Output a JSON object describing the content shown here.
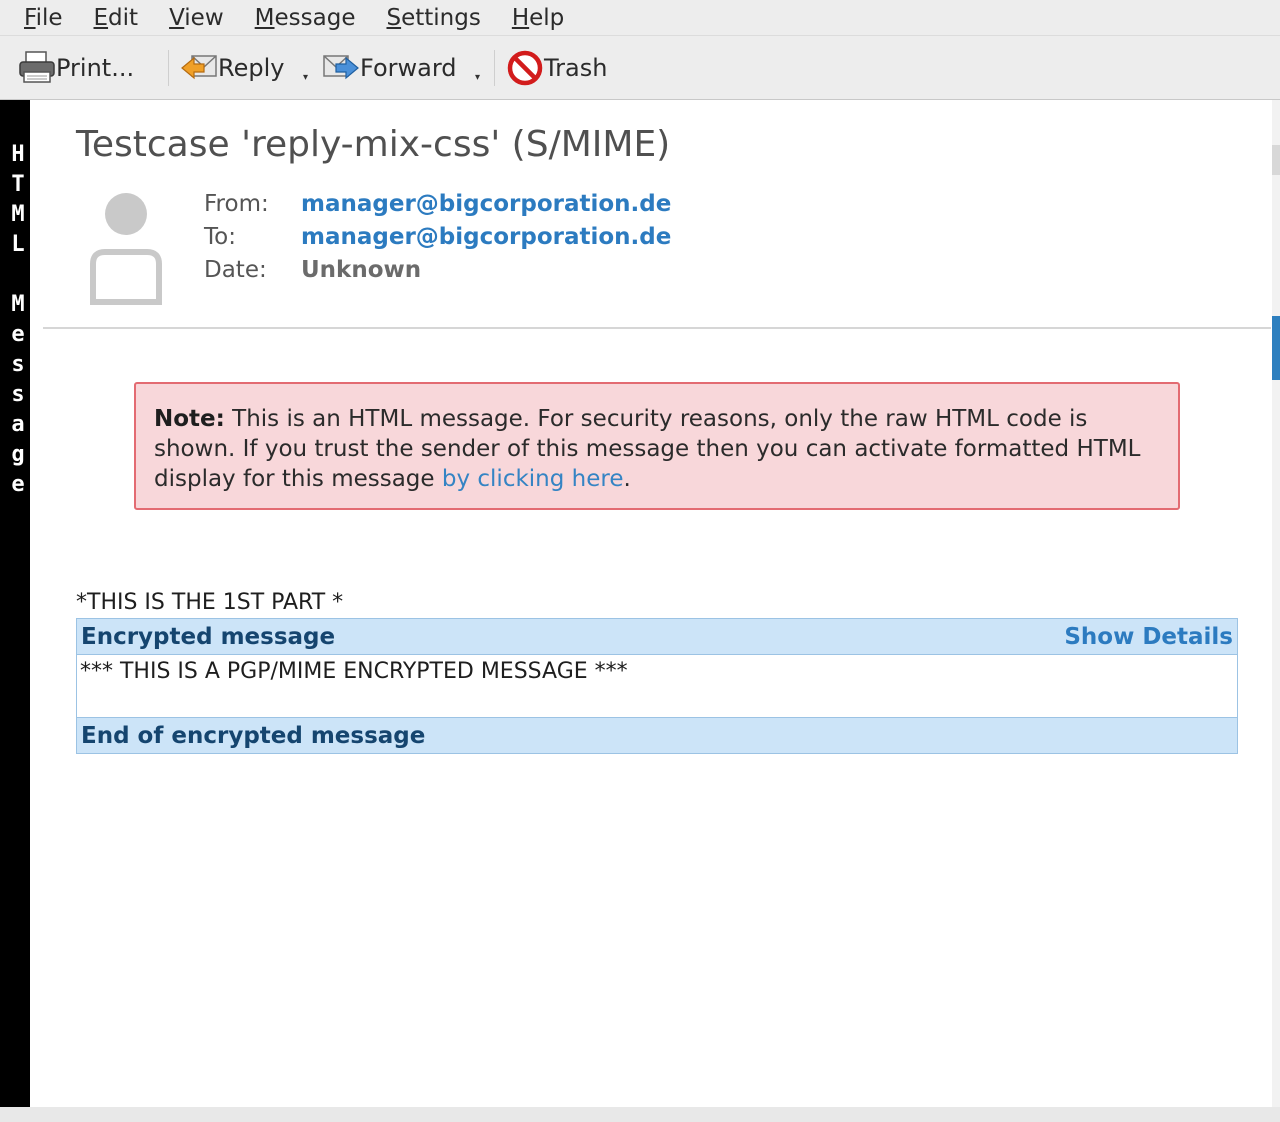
{
  "menubar": {
    "items": [
      {
        "mnemonic": "F",
        "rest": "ile"
      },
      {
        "mnemonic": "E",
        "rest": "dit"
      },
      {
        "mnemonic": "V",
        "rest": "iew"
      },
      {
        "mnemonic": "M",
        "rest": "essage"
      },
      {
        "mnemonic": "S",
        "rest": "ettings"
      },
      {
        "mnemonic": "H",
        "rest": "elp"
      }
    ]
  },
  "toolbar": {
    "print_label": "Print...",
    "reply_label": "Reply",
    "forward_label": "Forward",
    "trash_label": "Trash"
  },
  "sidebar": {
    "vertical_text": "H\nT\nM\nL\n \nM\ne\ns\ns\na\ng\ne"
  },
  "header": {
    "subject": "Testcase 'reply-mix-css' (S/MIME)",
    "from_label": "From:",
    "from_value": "manager@bigcorporation.de",
    "to_label": "To:",
    "to_value": "manager@bigcorporation.de",
    "date_label": "Date:",
    "date_value": "Unknown"
  },
  "note": {
    "bold": "Note:",
    "text": " This is an HTML message. For security reasons, only the raw HTML code is shown. If you trust the sender of this message then you can activate formatted HTML display for this message ",
    "link": "by clicking here",
    "end": "."
  },
  "body": {
    "part_label": "*THIS IS THE 1ST PART *",
    "encrypted_header": "Encrypted message",
    "show_details": "Show Details",
    "encrypted_content": "*** THIS IS A PGP/MIME ENCRYPTED MESSAGE ***",
    "encrypted_footer": "End of encrypted message"
  },
  "colors": {
    "link": "#2c7bc0",
    "note_bg": "#f8d7da",
    "note_border": "#e36b72",
    "encrypted_bg": "#cce4f8",
    "encrypted_text": "#15456f"
  }
}
